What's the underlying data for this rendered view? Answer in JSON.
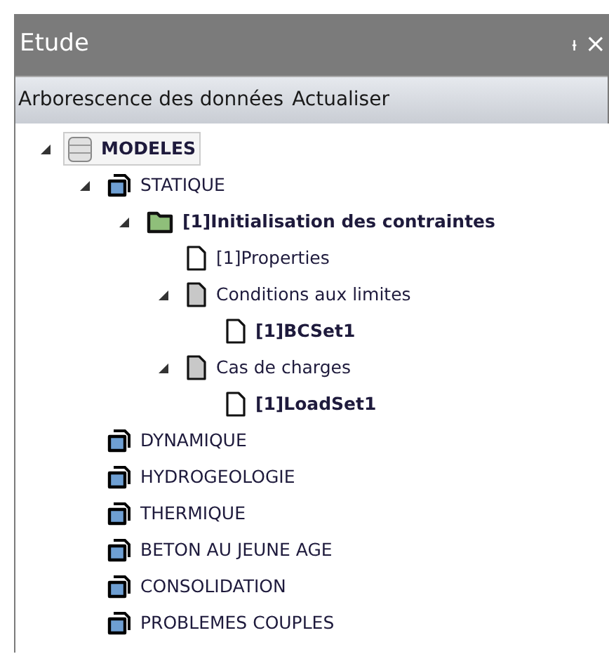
{
  "panel": {
    "title": "Etude",
    "pin": "ᵼ",
    "close": "×"
  },
  "toolbar": [
    "Arborescence des données",
    "Actualiser"
  ],
  "tree": [
    {
      "label": "MODELES",
      "kind": "database",
      "bold": true,
      "selected": true,
      "expanded": true,
      "children": [
        {
          "label": "STATIQUE",
          "kind": "folder",
          "bold": false,
          "selected": false,
          "expanded": true,
          "children": [
            {
              "label": "[1]Initialisation des contraintes",
              "kind": "green-folder",
              "bold": true,
              "selected": false,
              "expanded": true,
              "children": [
                {
                  "label": "[1]Properties",
                  "kind": "document",
                  "bold": false,
                  "selected": false
                },
                {
                  "label": "Conditions aux limites",
                  "kind": "grey-document",
                  "bold": false,
                  "selected": false,
                  "expanded": true,
                  "children": [
                    {
                      "label": "[1]BCSet1",
                      "kind": "document",
                      "bold": true,
                      "selected": false
                    }
                  ]
                },
                {
                  "label": "Cas de charges",
                  "kind": "grey-document",
                  "bold": false,
                  "selected": false,
                  "expanded": true,
                  "children": [
                    {
                      "label": "[1]LoadSet1",
                      "kind": "document",
                      "bold": true,
                      "selected": false
                    }
                  ]
                }
              ]
            }
          ]
        },
        {
          "label": "DYNAMIQUE",
          "kind": "folder",
          "bold": false,
          "selected": false
        },
        {
          "label": "HYDROGEOLOGIE",
          "kind": "folder",
          "bold": false,
          "selected": false
        },
        {
          "label": "THERMIQUE",
          "kind": "folder",
          "bold": false,
          "selected": false
        },
        {
          "label": "BETON AU JEUNE AGE",
          "kind": "folder",
          "bold": false,
          "selected": false
        },
        {
          "label": "CONSOLIDATION",
          "kind": "folder",
          "bold": false,
          "selected": false
        },
        {
          "label": "PROBLEMES COUPLES",
          "kind": "folder",
          "bold": false,
          "selected": false
        }
      ]
    }
  ]
}
